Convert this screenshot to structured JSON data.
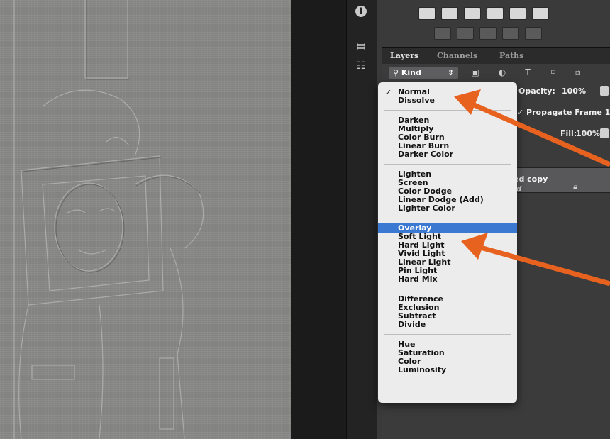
{
  "panel": {
    "tabs": [
      "Layers",
      "Channels",
      "Paths"
    ],
    "filter_kind": "Kind",
    "opacity_label": "Opacity:",
    "opacity_value": "100%",
    "propagate_label": "Propagate Frame 1",
    "fill_label": "Fill:",
    "fill_value": "100%",
    "layer_name": "ed copy",
    "layer2_name": "ed"
  },
  "blend_menu": {
    "checked": "Normal",
    "highlighted": "Overlay",
    "groups": [
      [
        "Normal",
        "Dissolve"
      ],
      [
        "Darken",
        "Multiply",
        "Color Burn",
        "Linear Burn",
        "Darker Color"
      ],
      [
        "Lighten",
        "Screen",
        "Color Dodge",
        "Linear Dodge (Add)",
        "Lighter Color"
      ],
      [
        "Overlay",
        "Soft Light",
        "Hard Light",
        "Vivid Light",
        "Linear Light",
        "Pin Light",
        "Hard Mix"
      ],
      [
        "Difference",
        "Exclusion",
        "Subtract",
        "Divide"
      ],
      [
        "Hue",
        "Saturation",
        "Color",
        "Luminosity"
      ]
    ]
  },
  "colors": {
    "highlight": "#3a78d2",
    "arrow": "#e8621f"
  },
  "icons": {
    "info": "info-icon",
    "panel": "panel-icon",
    "notes": "notes-icon",
    "lock": "lock-icon",
    "filter": [
      "image-filter-icon",
      "adjustment-filter-icon",
      "type-filter-icon",
      "shape-filter-icon",
      "smart-object-filter-icon"
    ]
  }
}
